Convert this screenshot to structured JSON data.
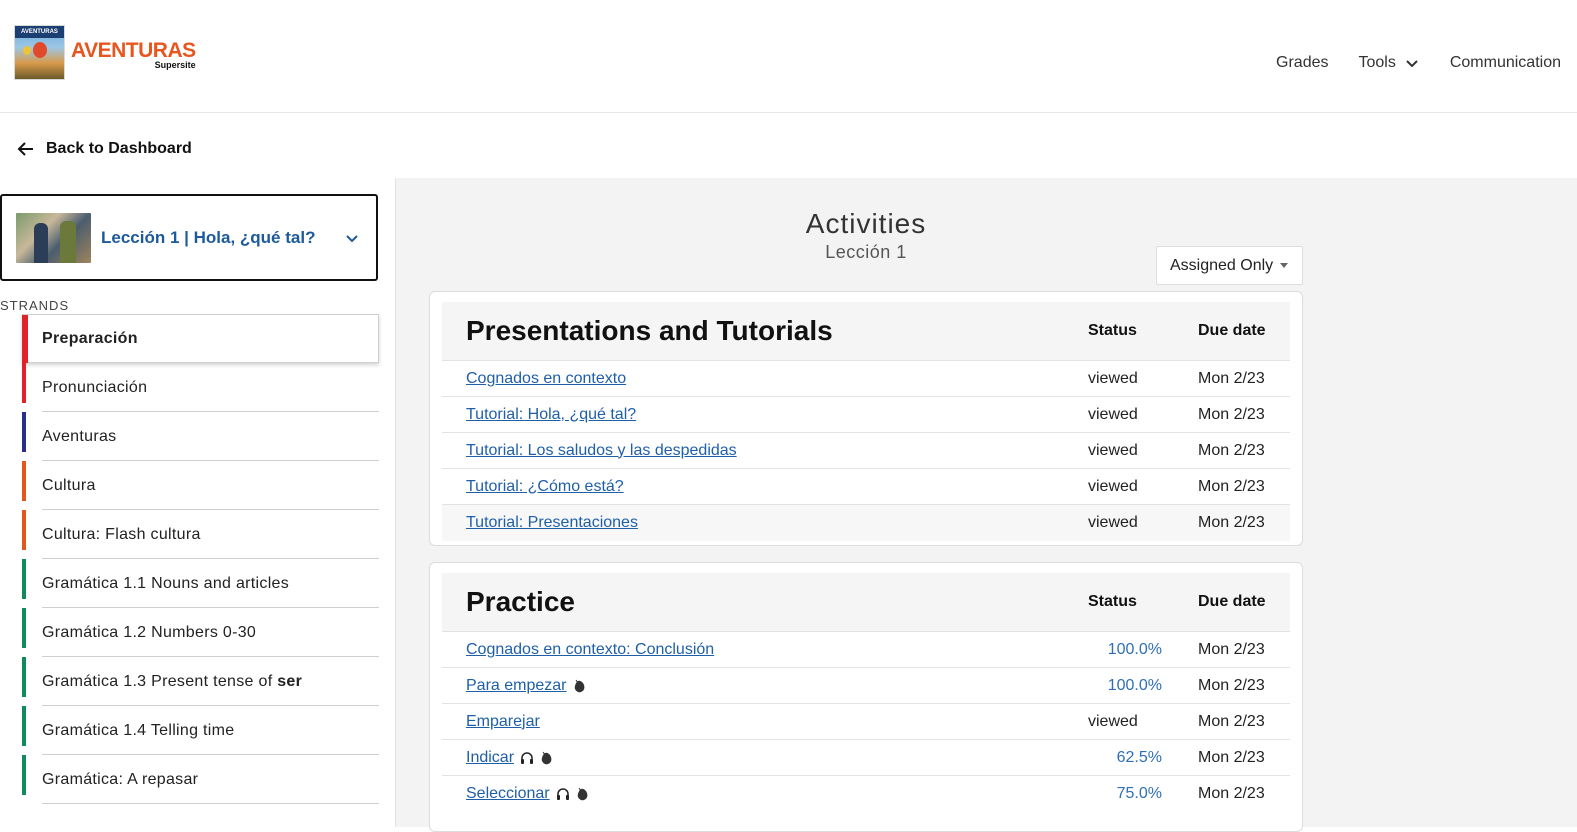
{
  "header": {
    "logo": {
      "title": "AVENTURAS",
      "sub": "Supersite",
      "banner": "AVENTURAS"
    },
    "nav": [
      {
        "label": "Grades"
      },
      {
        "label": "Tools"
      },
      {
        "label": "Communication"
      }
    ]
  },
  "back": {
    "label": "Back to Dashboard"
  },
  "sidebar": {
    "lesson_label": "Lección 1 | Hola, ¿qué tal?",
    "strands_heading": "STRANDS",
    "strands": [
      {
        "label": "Preparación",
        "color": "#e0232a",
        "active": true
      },
      {
        "label": "Pronunciación",
        "color": "#e0232a"
      },
      {
        "label": "Aventuras",
        "color": "#2a2f8f"
      },
      {
        "label": "Cultura",
        "color": "#e05a1f"
      },
      {
        "label": "Cultura: Flash cultura",
        "color": "#e05a1f"
      },
      {
        "label": "Gramática 1.1 Nouns and articles",
        "color": "#138a5e"
      },
      {
        "label": "Gramática 1.2 Numbers 0-30",
        "color": "#138a5e"
      },
      {
        "label": "Gramática 1.3 Present tense of ",
        "bold": "ser",
        "color": "#138a5e"
      },
      {
        "label": "Gramática 1.4 Telling time",
        "color": "#138a5e"
      },
      {
        "label": "Gramática: A repasar",
        "color": "#138a5e"
      }
    ]
  },
  "main": {
    "title": "Activities",
    "subtitle": "Lección 1",
    "filter": "Assigned Only",
    "sections": [
      {
        "heading": "Presentations and Tutorials",
        "status_col": "Status",
        "due_col": "Due date",
        "rows": [
          {
            "name": "Cognados en contexto",
            "status": "viewed",
            "due": "Mon 2/23"
          },
          {
            "name": "Tutorial: Hola, ¿qué tal?",
            "status": "viewed",
            "due": "Mon 2/23"
          },
          {
            "name": "Tutorial: Los saludos y las despedidas",
            "status": "viewed",
            "due": "Mon 2/23"
          },
          {
            "name": "Tutorial: ¿Cómo está?",
            "status": "viewed",
            "due": "Mon 2/23"
          },
          {
            "name": "Tutorial: Presentaciones",
            "status": "viewed",
            "due": "Mon 2/23"
          }
        ]
      },
      {
        "heading": "Practice",
        "status_col": "Status",
        "due_col": "Due date",
        "rows": [
          {
            "name": "Cognados en contexto: Conclusión",
            "status": "100.0%",
            "due": "Mon 2/23"
          },
          {
            "name": "Para empezar",
            "status": "100.0%",
            "due": "Mon 2/23",
            "icons": [
              "mouse-icon"
            ]
          },
          {
            "name": "Emparejar",
            "status": "viewed",
            "due": "Mon 2/23"
          },
          {
            "name": "Indicar",
            "status": "62.5%",
            "due": "Mon 2/23",
            "icons": [
              "headphones-icon",
              "mouse-icon"
            ]
          },
          {
            "name": "Seleccionar",
            "status": "75.0%",
            "due": "Mon 2/23",
            "icons": [
              "headphones-icon",
              "mouse-icon"
            ]
          }
        ]
      }
    ]
  }
}
